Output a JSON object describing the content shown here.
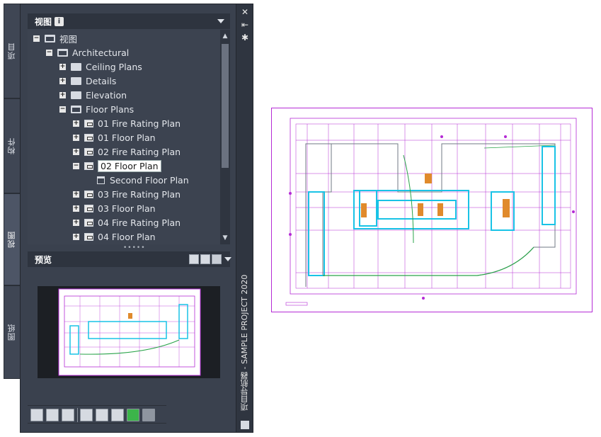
{
  "side_tabs": [
    {
      "label": "项目",
      "active": false
    },
    {
      "label": "构件",
      "active": false
    },
    {
      "label": "视图",
      "active": true
    },
    {
      "label": "图纸",
      "active": false
    }
  ],
  "palette": {
    "vertical_title": "项目导航器 - SAMPLE PROJECT 2020",
    "views_header": {
      "title": "视图",
      "info": "i"
    },
    "preview_header": {
      "title": "预览"
    }
  },
  "tree": {
    "items": [
      {
        "label": "视图",
        "level": 0,
        "expander": "−",
        "icon": "folder-open-icon"
      },
      {
        "label": "Architectural",
        "level": 1,
        "expander": "−",
        "icon": "folder-open-icon"
      },
      {
        "label": "Ceiling Plans",
        "level": 2,
        "expander": "+",
        "icon": "folder-icon"
      },
      {
        "label": "Details",
        "level": 2,
        "expander": "+",
        "icon": "folder-icon"
      },
      {
        "label": "Elevation",
        "level": 2,
        "expander": "+",
        "icon": "folder-icon"
      },
      {
        "label": "Floor Plans",
        "level": 2,
        "expander": "−",
        "icon": "folder-open-icon"
      },
      {
        "label": "01 Fire Rating Plan",
        "level": 3,
        "expander": "+",
        "icon": "view-icon"
      },
      {
        "label": "01 Floor Plan",
        "level": 3,
        "expander": "+",
        "icon": "view-icon"
      },
      {
        "label": "02 Fire Rating Plan",
        "level": 3,
        "expander": "+",
        "icon": "view-icon"
      },
      {
        "label": "02 Floor Plan",
        "level": 3,
        "expander": "−",
        "icon": "view-icon-locked",
        "selected": true
      },
      {
        "label": "Second Floor Plan",
        "level": 4,
        "expander": "",
        "icon": "sheet-view-icon"
      },
      {
        "label": "03 Fire Rating Plan",
        "level": 3,
        "expander": "+",
        "icon": "view-icon"
      },
      {
        "label": "03 Floor Plan",
        "level": 3,
        "expander": "+",
        "icon": "view-icon"
      },
      {
        "label": "04 Fire Rating Plan",
        "level": 3,
        "expander": "+",
        "icon": "view-icon"
      },
      {
        "label": "04 Floor Plan",
        "level": 3,
        "expander": "+",
        "icon": "view-icon"
      }
    ]
  },
  "colors": {
    "accent_magenta": "#b52bd5",
    "wall_cyan": "#19c3e6",
    "green_curve": "#2aa44a",
    "palette_bg": "#3a414e"
  }
}
